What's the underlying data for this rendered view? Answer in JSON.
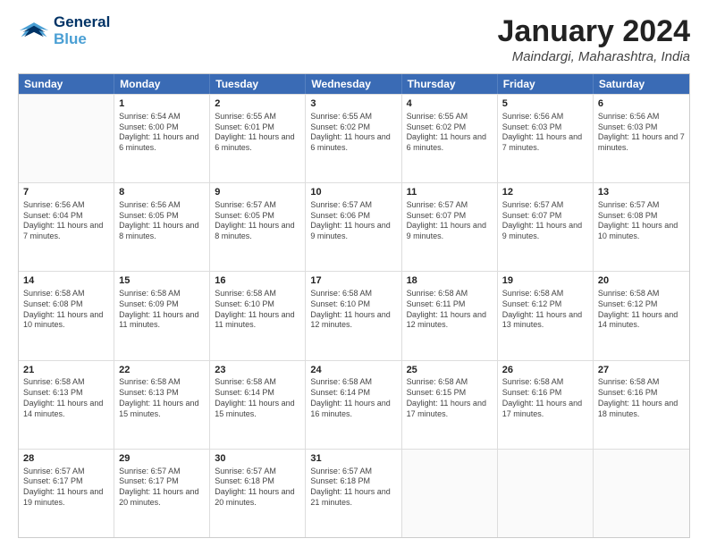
{
  "header": {
    "logo_line1": "General",
    "logo_line2": "Blue",
    "month_title": "January 2024",
    "location": "Maindargi, Maharashtra, India"
  },
  "weekdays": [
    "Sunday",
    "Monday",
    "Tuesday",
    "Wednesday",
    "Thursday",
    "Friday",
    "Saturday"
  ],
  "rows": [
    [
      {
        "day": "",
        "sunrise": "",
        "sunset": "",
        "daylight": "",
        "empty": true
      },
      {
        "day": "1",
        "sunrise": "Sunrise: 6:54 AM",
        "sunset": "Sunset: 6:00 PM",
        "daylight": "Daylight: 11 hours and 6 minutes."
      },
      {
        "day": "2",
        "sunrise": "Sunrise: 6:55 AM",
        "sunset": "Sunset: 6:01 PM",
        "daylight": "Daylight: 11 hours and 6 minutes."
      },
      {
        "day": "3",
        "sunrise": "Sunrise: 6:55 AM",
        "sunset": "Sunset: 6:02 PM",
        "daylight": "Daylight: 11 hours and 6 minutes."
      },
      {
        "day": "4",
        "sunrise": "Sunrise: 6:55 AM",
        "sunset": "Sunset: 6:02 PM",
        "daylight": "Daylight: 11 hours and 6 minutes."
      },
      {
        "day": "5",
        "sunrise": "Sunrise: 6:56 AM",
        "sunset": "Sunset: 6:03 PM",
        "daylight": "Daylight: 11 hours and 7 minutes."
      },
      {
        "day": "6",
        "sunrise": "Sunrise: 6:56 AM",
        "sunset": "Sunset: 6:03 PM",
        "daylight": "Daylight: 11 hours and 7 minutes."
      }
    ],
    [
      {
        "day": "7",
        "sunrise": "Sunrise: 6:56 AM",
        "sunset": "Sunset: 6:04 PM",
        "daylight": "Daylight: 11 hours and 7 minutes."
      },
      {
        "day": "8",
        "sunrise": "Sunrise: 6:56 AM",
        "sunset": "Sunset: 6:05 PM",
        "daylight": "Daylight: 11 hours and 8 minutes."
      },
      {
        "day": "9",
        "sunrise": "Sunrise: 6:57 AM",
        "sunset": "Sunset: 6:05 PM",
        "daylight": "Daylight: 11 hours and 8 minutes."
      },
      {
        "day": "10",
        "sunrise": "Sunrise: 6:57 AM",
        "sunset": "Sunset: 6:06 PM",
        "daylight": "Daylight: 11 hours and 9 minutes."
      },
      {
        "day": "11",
        "sunrise": "Sunrise: 6:57 AM",
        "sunset": "Sunset: 6:07 PM",
        "daylight": "Daylight: 11 hours and 9 minutes."
      },
      {
        "day": "12",
        "sunrise": "Sunrise: 6:57 AM",
        "sunset": "Sunset: 6:07 PM",
        "daylight": "Daylight: 11 hours and 9 minutes."
      },
      {
        "day": "13",
        "sunrise": "Sunrise: 6:57 AM",
        "sunset": "Sunset: 6:08 PM",
        "daylight": "Daylight: 11 hours and 10 minutes."
      }
    ],
    [
      {
        "day": "14",
        "sunrise": "Sunrise: 6:58 AM",
        "sunset": "Sunset: 6:08 PM",
        "daylight": "Daylight: 11 hours and 10 minutes."
      },
      {
        "day": "15",
        "sunrise": "Sunrise: 6:58 AM",
        "sunset": "Sunset: 6:09 PM",
        "daylight": "Daylight: 11 hours and 11 minutes."
      },
      {
        "day": "16",
        "sunrise": "Sunrise: 6:58 AM",
        "sunset": "Sunset: 6:10 PM",
        "daylight": "Daylight: 11 hours and 11 minutes."
      },
      {
        "day": "17",
        "sunrise": "Sunrise: 6:58 AM",
        "sunset": "Sunset: 6:10 PM",
        "daylight": "Daylight: 11 hours and 12 minutes."
      },
      {
        "day": "18",
        "sunrise": "Sunrise: 6:58 AM",
        "sunset": "Sunset: 6:11 PM",
        "daylight": "Daylight: 11 hours and 12 minutes."
      },
      {
        "day": "19",
        "sunrise": "Sunrise: 6:58 AM",
        "sunset": "Sunset: 6:12 PM",
        "daylight": "Daylight: 11 hours and 13 minutes."
      },
      {
        "day": "20",
        "sunrise": "Sunrise: 6:58 AM",
        "sunset": "Sunset: 6:12 PM",
        "daylight": "Daylight: 11 hours and 14 minutes."
      }
    ],
    [
      {
        "day": "21",
        "sunrise": "Sunrise: 6:58 AM",
        "sunset": "Sunset: 6:13 PM",
        "daylight": "Daylight: 11 hours and 14 minutes."
      },
      {
        "day": "22",
        "sunrise": "Sunrise: 6:58 AM",
        "sunset": "Sunset: 6:13 PM",
        "daylight": "Daylight: 11 hours and 15 minutes."
      },
      {
        "day": "23",
        "sunrise": "Sunrise: 6:58 AM",
        "sunset": "Sunset: 6:14 PM",
        "daylight": "Daylight: 11 hours and 15 minutes."
      },
      {
        "day": "24",
        "sunrise": "Sunrise: 6:58 AM",
        "sunset": "Sunset: 6:14 PM",
        "daylight": "Daylight: 11 hours and 16 minutes."
      },
      {
        "day": "25",
        "sunrise": "Sunrise: 6:58 AM",
        "sunset": "Sunset: 6:15 PM",
        "daylight": "Daylight: 11 hours and 17 minutes."
      },
      {
        "day": "26",
        "sunrise": "Sunrise: 6:58 AM",
        "sunset": "Sunset: 6:16 PM",
        "daylight": "Daylight: 11 hours and 17 minutes."
      },
      {
        "day": "27",
        "sunrise": "Sunrise: 6:58 AM",
        "sunset": "Sunset: 6:16 PM",
        "daylight": "Daylight: 11 hours and 18 minutes."
      }
    ],
    [
      {
        "day": "28",
        "sunrise": "Sunrise: 6:57 AM",
        "sunset": "Sunset: 6:17 PM",
        "daylight": "Daylight: 11 hours and 19 minutes."
      },
      {
        "day": "29",
        "sunrise": "Sunrise: 6:57 AM",
        "sunset": "Sunset: 6:17 PM",
        "daylight": "Daylight: 11 hours and 20 minutes."
      },
      {
        "day": "30",
        "sunrise": "Sunrise: 6:57 AM",
        "sunset": "Sunset: 6:18 PM",
        "daylight": "Daylight: 11 hours and 20 minutes."
      },
      {
        "day": "31",
        "sunrise": "Sunrise: 6:57 AM",
        "sunset": "Sunset: 6:18 PM",
        "daylight": "Daylight: 11 hours and 21 minutes."
      },
      {
        "day": "",
        "sunrise": "",
        "sunset": "",
        "daylight": "",
        "empty": true
      },
      {
        "day": "",
        "sunrise": "",
        "sunset": "",
        "daylight": "",
        "empty": true
      },
      {
        "day": "",
        "sunrise": "",
        "sunset": "",
        "daylight": "",
        "empty": true
      }
    ]
  ]
}
